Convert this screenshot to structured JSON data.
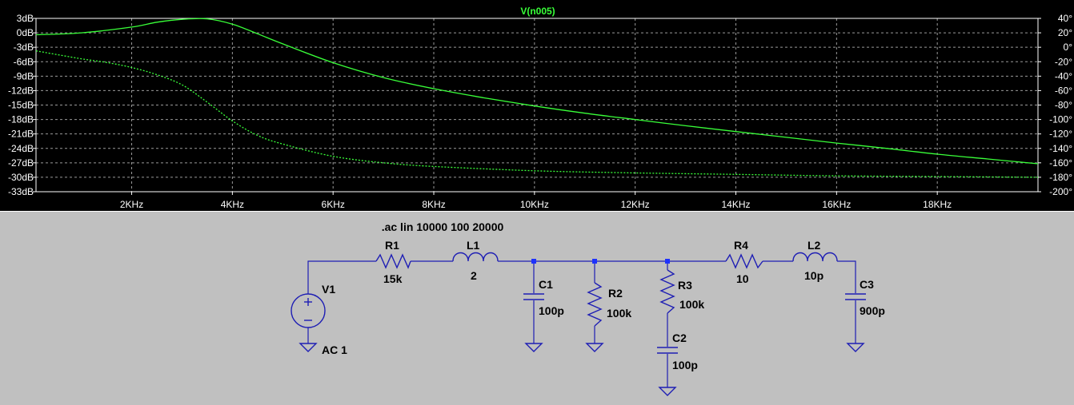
{
  "plot": {
    "title": "V(n005)",
    "y_ticks": [
      "3dB",
      "0dB",
      "-3dB",
      "-6dB",
      "-9dB",
      "-12dB",
      "-15dB",
      "-18dB",
      "-21dB",
      "-24dB",
      "-27dB",
      "-30dB",
      "-33dB"
    ],
    "phase_ticks": [
      "40°",
      "20°",
      "0°",
      "-20°",
      "-40°",
      "-60°",
      "-80°",
      "-100°",
      "-120°",
      "-140°",
      "-160°",
      "-180°",
      "-200°"
    ],
    "x_ticks": [
      "2KHz",
      "4KHz",
      "6KHz",
      "8KHz",
      "10KHz",
      "12KHz",
      "14KHz",
      "16KHz",
      "18KHz"
    ],
    "colors": {
      "background": "#000000",
      "grid": "#9a9a9a",
      "trace": "#39ff39"
    }
  },
  "chart_data": {
    "type": "line",
    "title": "V(n005)",
    "xlabel": "",
    "ylabel": "",
    "x_unit": "Hz",
    "xlim": [
      100,
      20000
    ],
    "ylim": [
      -33,
      3
    ],
    "y2lim": [
      -200,
      40
    ],
    "grid": true,
    "series": [
      {
        "name": "V(n005)",
        "axis": "left",
        "style": "solid",
        "x": [
          100,
          1000,
          2000,
          2500,
          3000,
          3500,
          4000,
          4500,
          5000,
          6000,
          7000,
          8000,
          9000,
          10000,
          11000,
          12000,
          13000,
          14000,
          15000,
          16000,
          17000,
          18000,
          19000,
          20000
        ],
        "y": [
          -0.4,
          0,
          1.2,
          2.2,
          2.8,
          2.9,
          1.8,
          -0.2,
          -2.3,
          -6.2,
          -9.3,
          -11.6,
          -13.5,
          -15.2,
          -16.7,
          -18.0,
          -19.3,
          -20.5,
          -21.7,
          -22.9,
          -24.0,
          -25.2,
          -26.2,
          -27.2
        ]
      },
      {
        "name": "V(n005)",
        "axis": "right",
        "style": "dotted",
        "x": [
          100,
          1000,
          1500,
          2000,
          2500,
          3000,
          3500,
          4000,
          4500,
          5000,
          6000,
          7000,
          8000,
          10000,
          12000,
          14000,
          16000,
          18000,
          20000
        ],
        "y": [
          -5,
          -16,
          -21,
          -28,
          -38,
          -52,
          -76,
          -102,
          -122,
          -134,
          -151,
          -160,
          -165,
          -171,
          -174,
          -176,
          -178,
          -179,
          -180
        ]
      }
    ]
  },
  "schematic": {
    "directive": ".ac lin 10000 100 20000",
    "components": {
      "V1": {
        "name": "V1",
        "value": "AC 1"
      },
      "R1": {
        "name": "R1",
        "value": "15k"
      },
      "L1": {
        "name": "L1",
        "value": "2"
      },
      "C1": {
        "name": "C1",
        "value": "100p"
      },
      "R2": {
        "name": "R2",
        "value": "100k"
      },
      "R3": {
        "name": "R3",
        "value": "100k"
      },
      "C2": {
        "name": "C2",
        "value": "100p"
      },
      "R4": {
        "name": "R4",
        "value": "10"
      },
      "L2": {
        "name": "L2",
        "value": "10p"
      },
      "C3": {
        "name": "C3",
        "value": "900p"
      }
    },
    "colors": {
      "background": "#c0c0c0",
      "wire": "#1e1eb4",
      "junction": "#1e32ff",
      "text": "#000000"
    }
  }
}
